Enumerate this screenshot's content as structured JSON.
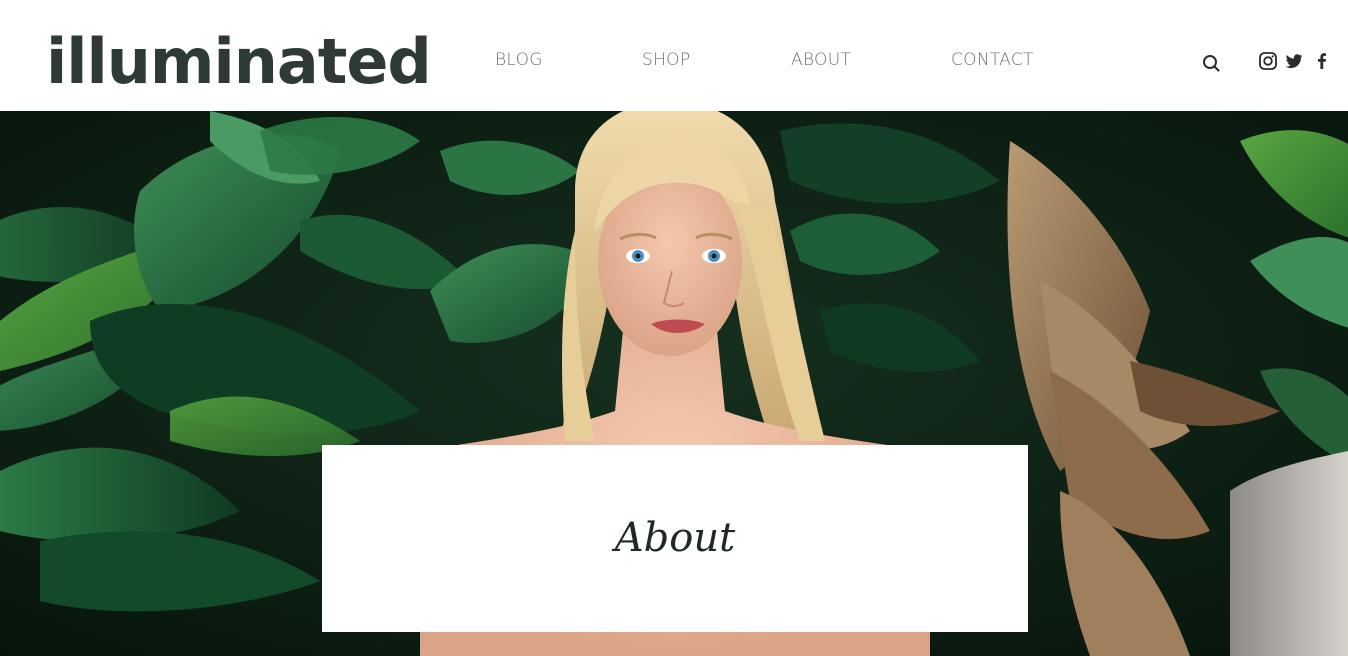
{
  "site": {
    "logo": "illuminated"
  },
  "nav": {
    "items": [
      "BLOG",
      "SHOP",
      "ABOUT",
      "CONTACT"
    ]
  },
  "header_icons": {
    "search": "search-icon",
    "social": [
      "instagram-icon",
      "twitter-icon",
      "facebook-icon"
    ]
  },
  "hero": {
    "image": "portrait-woman-tropical-leaves"
  },
  "page": {
    "title": "About"
  },
  "colors": {
    "logo": "#2f3a38",
    "nav_text": "#6f6f6f",
    "title": "#1e2a22",
    "background": "#ffffff"
  }
}
